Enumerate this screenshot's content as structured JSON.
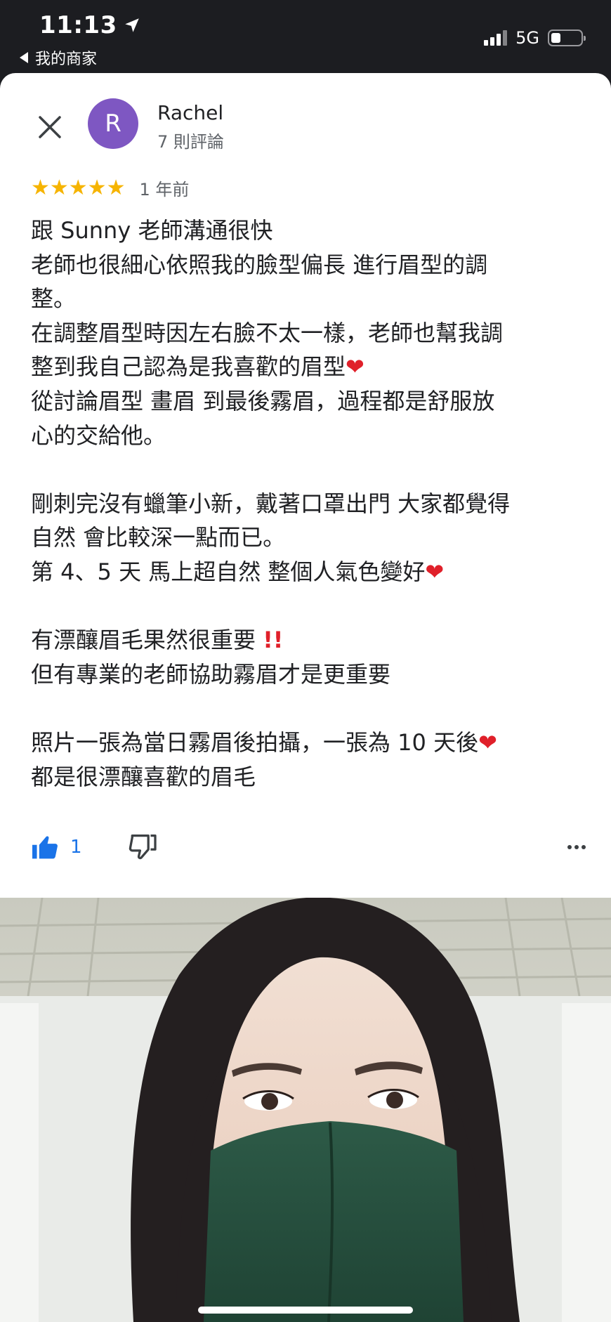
{
  "status_bar": {
    "time": "11:13",
    "back_app": "我的商家",
    "network": "5G"
  },
  "reviewer": {
    "avatar_letter": "R",
    "name": "Rachel",
    "review_count": "7 則評論"
  },
  "review": {
    "stars": "★★★★★",
    "rating": 5,
    "time": "1 年前",
    "lines": [
      "跟 Sunny 老師溝通很快",
      "老師也很細心依照我的臉型偏長 進行眉型的調",
      "整。",
      "在調整眉型時因左右臉不太一樣，老師也幫我調",
      "整到我自己認為是我喜歡的眉型",
      "從討論眉型 畫眉 到最後霧眉，過程都是舒服放",
      "心的交給他。",
      "",
      "剛刺完沒有蠟筆小新，戴著口罩出門 大家都覺得",
      "自然 會比較深一點而已。",
      "第 4、5 天 馬上超自然 整個人氣色變好",
      "",
      "有漂釀眉毛果然很重要",
      "但有專業的老師協助霧眉才是更重要",
      "",
      "照片一張為當日霧眉後拍攝，一張為 10 天後",
      "都是很漂釀喜歡的眉毛"
    ],
    "heart": "❤",
    "double_bang": "!!"
  },
  "actions": {
    "like_count": "1"
  },
  "colors": {
    "accent": "#1a73e8",
    "star": "#f6b400",
    "avatar": "#7e57c2",
    "heart": "#e0202a"
  }
}
